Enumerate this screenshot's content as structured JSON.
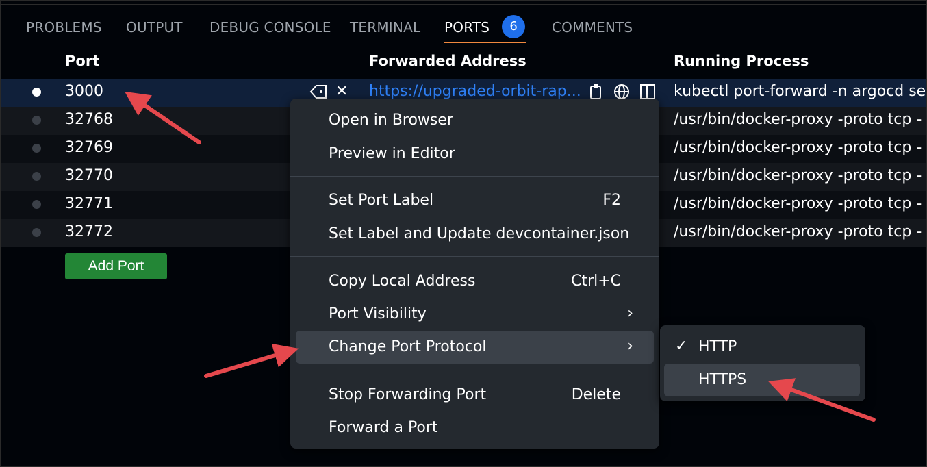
{
  "tabs": [
    {
      "label": "PROBLEMS"
    },
    {
      "label": "OUTPUT"
    },
    {
      "label": "DEBUG CONSOLE"
    },
    {
      "label": "TERMINAL"
    },
    {
      "label": "PORTS",
      "badge": "6",
      "active": true
    },
    {
      "label": "COMMENTS"
    }
  ],
  "table": {
    "headers": {
      "port": "Port",
      "address": "Forwarded Address",
      "process": "Running Process"
    },
    "rows": [
      {
        "port": "3000",
        "address": "https://upgraded-orbit-rap...",
        "process": "kubectl port-forward -n argocd ser"
      },
      {
        "port": "32768",
        "address": "",
        "process": "/usr/bin/docker-proxy -proto tcp -"
      },
      {
        "port": "32769",
        "address": "",
        "process": "/usr/bin/docker-proxy -proto tcp -"
      },
      {
        "port": "32770",
        "address": "",
        "process": "/usr/bin/docker-proxy -proto tcp -"
      },
      {
        "port": "32771",
        "address": "",
        "process": "/usr/bin/docker-proxy -proto tcp -"
      },
      {
        "port": "32772",
        "address": "",
        "process": "/usr/bin/docker-proxy -proto tcp -"
      }
    ],
    "add_button": "Add Port",
    "row_icons": {
      "label": "tag-icon",
      "close": "✕",
      "copy": "copy-icon",
      "browser": "globe-icon",
      "preview": "preview-icon"
    }
  },
  "context_menu": {
    "items": [
      {
        "label": "Open in Browser"
      },
      {
        "label": "Preview in Editor"
      },
      {
        "label": "Set Port Label",
        "shortcut": "F2"
      },
      {
        "label": "Set Label and Update devcontainer.json"
      },
      {
        "label": "Copy Local Address",
        "shortcut": "Ctrl+C"
      },
      {
        "label": "Port Visibility",
        "chevron": "›"
      },
      {
        "label": "Change Port Protocol",
        "chevron": "›",
        "highlighted": true
      },
      {
        "label": "Stop Forwarding Port",
        "shortcut": "Delete"
      },
      {
        "label": "Forward a Port"
      }
    ]
  },
  "submenu": {
    "items": [
      {
        "label": "HTTP",
        "checked": "✓"
      },
      {
        "label": "HTTPS",
        "highlighted": true
      }
    ]
  },
  "colors": {
    "accent": "#1f6feb",
    "link": "#2f81f7",
    "add_button": "#238636",
    "annotation_arrow": "#e5484d"
  }
}
